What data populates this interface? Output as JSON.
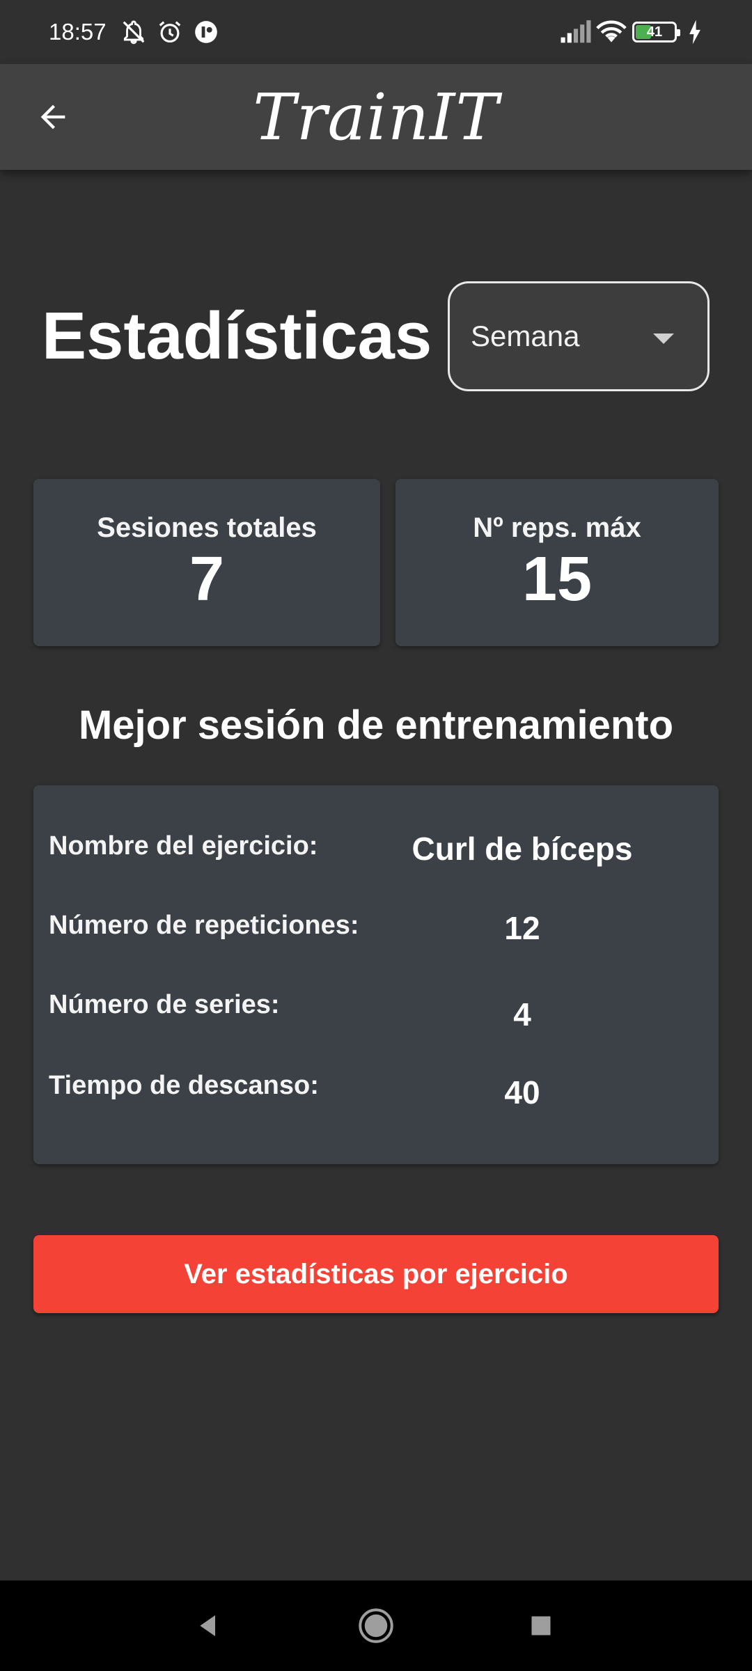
{
  "status_bar": {
    "time": "18:57",
    "battery_level": "41",
    "icons": [
      "notifications-off-icon",
      "alarm-icon",
      "app-notification-icon",
      "signal-icon",
      "wifi-icon",
      "battery-icon",
      "charging-icon"
    ]
  },
  "app_bar": {
    "title": "TrainIT",
    "back_icon": "arrow-back-icon"
  },
  "header": {
    "title": "Estadísticas",
    "period_select": {
      "value": "Semana",
      "icon": "chevron-down-icon"
    }
  },
  "stats": {
    "total_sessions": {
      "label": "Sesiones totales",
      "value": "7"
    },
    "max_reps": {
      "label": "Nº reps. máx",
      "value": "15"
    }
  },
  "best_session": {
    "title": "Mejor sesión de entrenamiento",
    "rows": [
      {
        "label": "Nombre del ejercicio:",
        "value": "Curl de bíceps"
      },
      {
        "label": "Número de repeticiones:",
        "value": "12"
      },
      {
        "label": "Número de series:",
        "value": "4"
      },
      {
        "label": "Tiempo de descanso:",
        "value": "40"
      }
    ]
  },
  "actions": {
    "exercise_stats_label": "Ver estadísticas por ejercicio"
  },
  "colors": {
    "background": "#303030",
    "app_bar": "#424242",
    "card": "#3b4147",
    "primary_button": "#f44336",
    "battery_fill": "#4caf50"
  }
}
